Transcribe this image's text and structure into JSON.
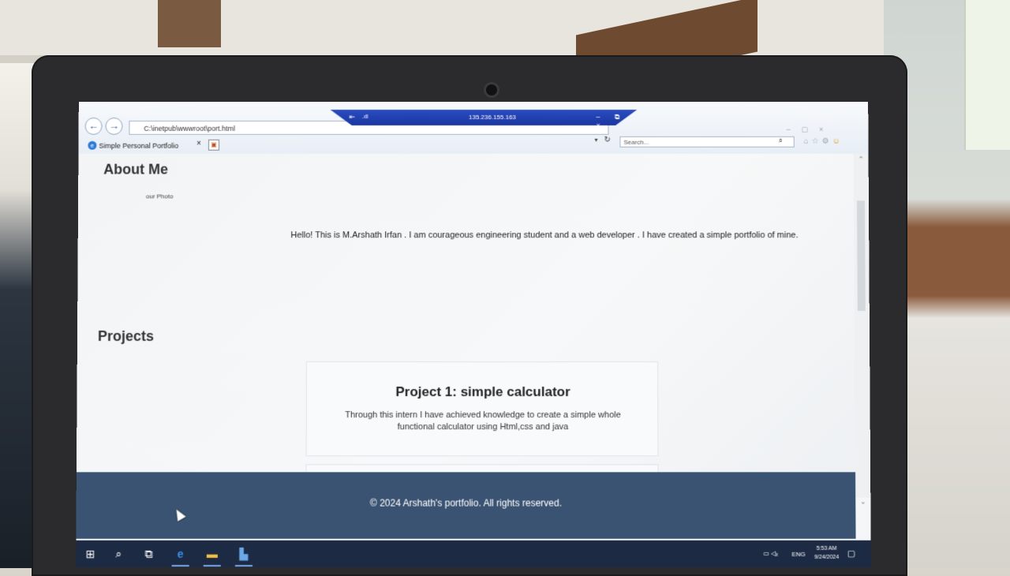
{
  "browser": {
    "address": "C:\\inetpub\\wwwroot\\port.html",
    "search_placeholder": "Search...",
    "tab_title": "Simple Personal Portfolio",
    "tab_close": "×",
    "refresh": "↻",
    "search_icon": "⌕",
    "dropdown": "▾"
  },
  "remote_bar": {
    "ip": "135.236.155.163",
    "controls": "–  ⧉  ×"
  },
  "about": {
    "heading": "About Me",
    "photo_alt": "our Photo",
    "text": "Hello! This is M.Arshath Irfan . I am courageous engineering student and a web developer . I have created a simple portfolio of mine."
  },
  "projects": {
    "heading": "Projects",
    "items": [
      {
        "title": "Project 1: simple calculator",
        "description": "Through this intern I have achieved knowledge to create a simple whole functional calculator using Html,css and java"
      }
    ]
  },
  "footer": {
    "text": "© 2024 Arshath's portfolio. All rights reserved."
  },
  "taskbar": {
    "lang": "ENG",
    "time": "5:53 AM",
    "date": "9/24/2024"
  },
  "colors": {
    "footer_bg": "#3a5372",
    "taskbar_bg": "#1c2a44",
    "rdp_bar": "#2a4cc0"
  },
  "icons": [
    "back-icon",
    "forward-icon",
    "page-icon",
    "refresh-icon",
    "search-icon",
    "home-icon",
    "star-icon",
    "gear-icon",
    "smiley-icon",
    "windows-icon",
    "taskview-icon",
    "edge-icon",
    "file-explorer-icon",
    "network-icon",
    "volume-icon",
    "notification-icon"
  ]
}
